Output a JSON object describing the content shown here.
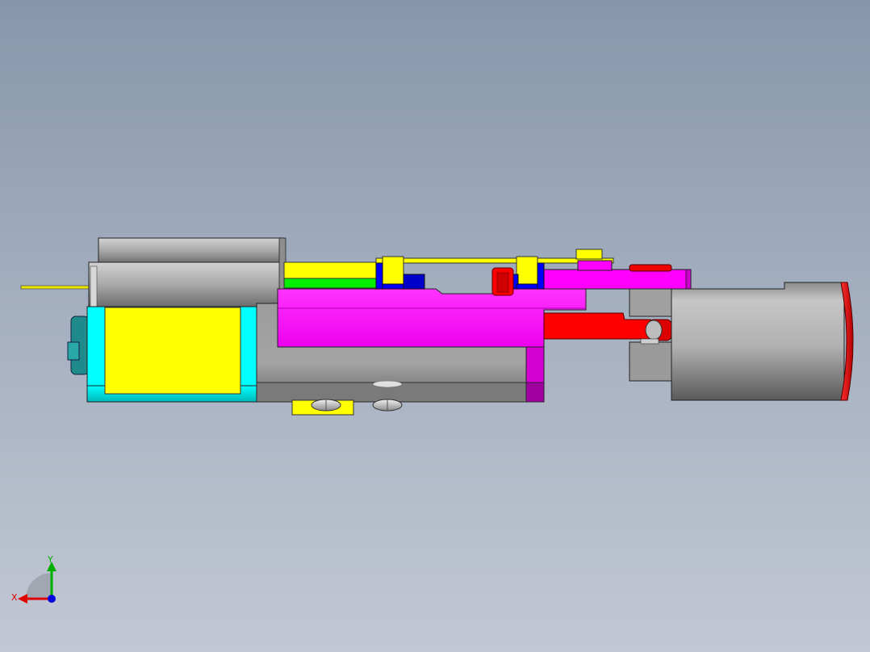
{
  "viewport": {
    "background_top": "#8796ab",
    "background_bottom": "#c2c8d3",
    "cursor": "default"
  },
  "model": {
    "view": "front",
    "part_colors": {
      "housing_gray": "#a8a8a8",
      "motor_yellow": "#ffff00",
      "motor_cyan": "#00ffff",
      "carriage_magenta": "#ff00ff",
      "lever_red": "#ff0000",
      "bracket_blue": "#0000ff",
      "plate_green": "#00ee00",
      "knob_dark_gray": "#6e6e6e"
    }
  },
  "triad": {
    "x_label": "X",
    "y_label": "Y",
    "x_color": "#e00000",
    "y_color": "#00b000",
    "z_color": "#0000e0"
  }
}
